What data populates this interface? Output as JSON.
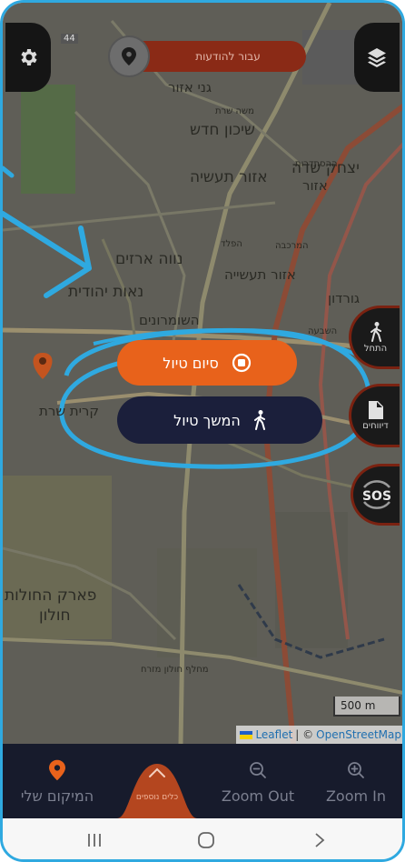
{
  "top_bar": {
    "notification_label": "עבור להודעות"
  },
  "map": {
    "road_number": "44",
    "labels": [
      "גני אזור",
      "שיכון חדש",
      "משה שרת",
      "אזור תעשיה",
      "יצחק שדה",
      "אזור",
      "נווה ארזים",
      "אזור תעשייה",
      "נאות יהודית",
      "השומרונים",
      "קרית שרת",
      "פארק החולות",
      "חולון",
      "מחלף חולון מזרח",
      "גורדון",
      "השבעה",
      "ההסתדרות",
      "הפלד",
      "המרכבה"
    ]
  },
  "side_buttons": {
    "start_label": "התחל",
    "reports_label": "דיווחים",
    "sos_label": "SOS"
  },
  "dialog": {
    "end_trip_label": "סיום טיול",
    "continue_trip_label": "המשך טיול"
  },
  "scale": "500 m",
  "attribution": {
    "leaflet": "Leaflet",
    "separator": "| ©",
    "osm": "OpenStreetMap"
  },
  "bottom_nav": {
    "my_location_label": "המיקום שלי",
    "more_tools_label": "כלים נוספים",
    "zoom_out_label": "Zoom Out",
    "zoom_in_label": "Zoom In"
  },
  "colors": {
    "accent_orange": "#e8621b",
    "navy": "#1b1f3b",
    "annotation_blue": "#2fa9e0",
    "nav_bg": "#171b2c"
  }
}
